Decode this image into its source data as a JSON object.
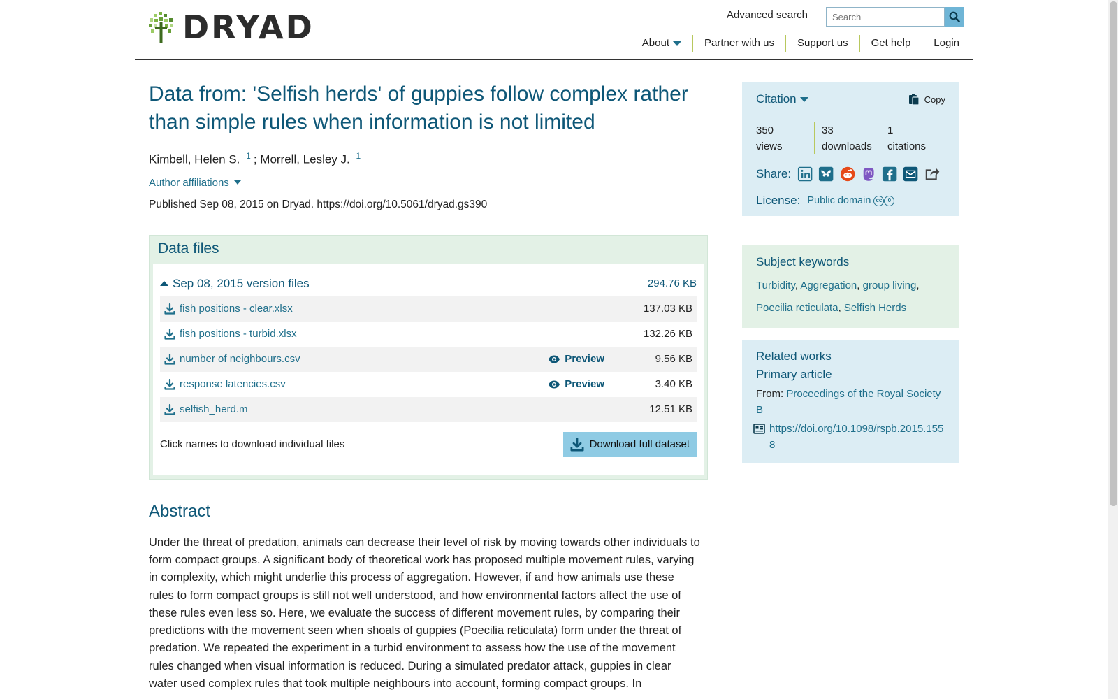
{
  "header": {
    "logo_text": "DRYAD",
    "advanced_search": "Advanced search",
    "search_placeholder": "Search",
    "nav": [
      "About",
      "Partner with us",
      "Support us",
      "Get help",
      "Login"
    ]
  },
  "dataset": {
    "title": "Data from: 'Selfish herds' of guppies follow complex rather than simple rules when information is not limited",
    "authors": [
      {
        "name": "Kimbell, Helen S.",
        "affil_ref": "1"
      },
      {
        "name": "Morrell, Lesley J.",
        "affil_ref": "1"
      }
    ],
    "author_separator": ";",
    "author_affiliations": "Author affiliations",
    "published": "Published Sep 08, 2015 on Dryad. https://doi.org/10.5061/dryad.gs390"
  },
  "files": {
    "heading": "Data files",
    "version_title": "Sep 08, 2015 version files",
    "version_size": "294.76 KB",
    "preview_label": "Preview",
    "rows": [
      {
        "name": "fish positions - clear.xlsx",
        "size": "137.03 KB"
      },
      {
        "name": "fish positions - turbid.xlsx",
        "size": "132.26 KB"
      },
      {
        "name": "number of neighbours.csv",
        "size": "9.56 KB"
      },
      {
        "name": "response latencies.csv",
        "size": "3.40 KB"
      },
      {
        "name": "selfish_herd.m",
        "size": "12.51 KB"
      }
    ],
    "hint": "Click names to download individual files",
    "download_full": "Download full dataset"
  },
  "abstract": {
    "heading": "Abstract",
    "text": "Under the threat of predation, animals can decrease their level of risk by moving towards other individuals to form compact groups. A significant body of theoretical work has proposed multiple movement rules, varying in complexity, which might underlie this process of aggregation. However, if and how animals use these rules to form compact groups is still not well understood, and how environmental factors affect the use of these rules even less so. Here, we evaluate the success of different movement rules, by comparing their predictions with the movement seen when shoals of guppies (Poecilia reticulata) form under the threat of predation. We repeated the experiment in a turbid environment to assess how the use of the movement rules changed when visual information is reduced. During a simulated predator attack, guppies in clear water used complex rules that took multiple neighbours into account, forming compact groups. In"
  },
  "sidebar": {
    "citation_label": "Citation",
    "copy_label": "Copy",
    "metrics": [
      {
        "value": "350",
        "label": "views"
      },
      {
        "value": "33",
        "label": "downloads"
      },
      {
        "value": "1",
        "label": "citations"
      }
    ],
    "share_label": "Share:",
    "share_icons": [
      "linkedin-icon",
      "bluesky-icon",
      "reddit-icon",
      "mastodon-icon",
      "facebook-icon",
      "email-icon",
      "share-icon"
    ],
    "license_label": "License:",
    "license_value": "Public domain",
    "keywords_heading": "Subject keywords",
    "keywords": [
      "Turbidity",
      "Aggregation",
      "group living",
      "Poecilia reticulata",
      "Selfish Herds"
    ],
    "related_heading": "Related works",
    "primary_heading": "Primary article",
    "from_label": "From:",
    "from_value": "Proceedings of the Royal Society B",
    "doi": "https://doi.org/10.1098/rspb.2015.1558"
  },
  "colors": {
    "primary": "#0e5777",
    "link": "#1f6f8b",
    "accent_green": "#b8c85e",
    "files_bg": "#e3f1e6",
    "side_blue": "#dcedf4",
    "button_blue": "#8fcbe4"
  }
}
